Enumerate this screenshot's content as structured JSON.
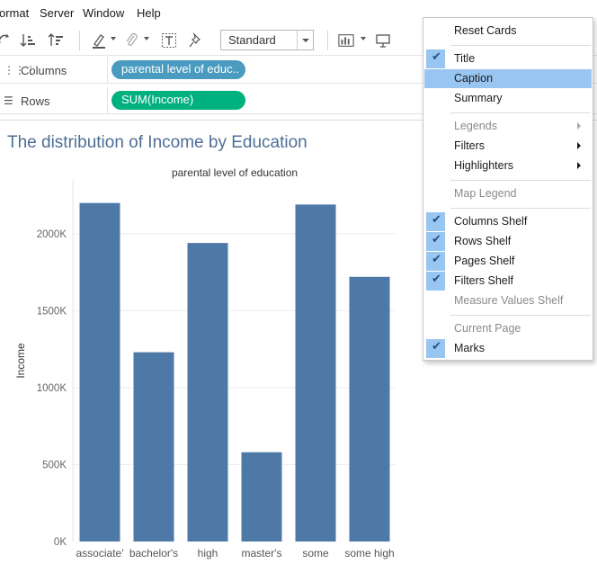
{
  "menubar": {
    "items": [
      "ormat",
      "Server",
      "Window",
      "Help"
    ]
  },
  "toolbar": {
    "view_mode": "Standard"
  },
  "shelves": {
    "columns": {
      "label": "Columns",
      "pill": "parental level of educ.."
    },
    "rows": {
      "label": "Rows",
      "pill": "SUM(Income)"
    }
  },
  "worksheet": {
    "title": "The distribution of Income by Education"
  },
  "chart_data": {
    "type": "bar",
    "column_header": "parental level of education",
    "categories": [
      "associate'",
      "bachelor's",
      "high",
      "master's",
      "some",
      "some high"
    ],
    "values": [
      2200000,
      1230000,
      1940000,
      580000,
      2190000,
      1720000
    ],
    "ylabel": "Income",
    "yticks": [
      "0K",
      "500K",
      "1000K",
      "1500K",
      "2000K"
    ],
    "ytick_values": [
      0,
      500000,
      1000000,
      1500000,
      2000000
    ],
    "ylim": [
      0,
      2350000
    ],
    "bar_color": "#4e79a7",
    "grid": true
  },
  "context_menu": {
    "items": [
      {
        "label": "Reset Cards",
        "checked": false,
        "disabled": false,
        "submenu": false,
        "highlighted": false
      },
      {
        "separator": true
      },
      {
        "label": "Title",
        "checked": true,
        "disabled": false,
        "submenu": false,
        "highlighted": false
      },
      {
        "label": "Caption",
        "checked": false,
        "disabled": false,
        "submenu": false,
        "highlighted": true
      },
      {
        "label": "Summary",
        "checked": false,
        "disabled": false,
        "submenu": false,
        "highlighted": false
      },
      {
        "separator": true
      },
      {
        "label": "Legends",
        "checked": false,
        "disabled": true,
        "submenu": true,
        "highlighted": false
      },
      {
        "label": "Filters",
        "checked": false,
        "disabled": false,
        "submenu": true,
        "highlighted": false
      },
      {
        "label": "Highlighters",
        "checked": false,
        "disabled": false,
        "submenu": true,
        "highlighted": false
      },
      {
        "separator": true
      },
      {
        "label": "Map Legend",
        "checked": false,
        "disabled": true,
        "submenu": false,
        "highlighted": false
      },
      {
        "separator": true
      },
      {
        "label": "Columns Shelf",
        "checked": true,
        "disabled": false,
        "submenu": false,
        "highlighted": false
      },
      {
        "label": "Rows Shelf",
        "checked": true,
        "disabled": false,
        "submenu": false,
        "highlighted": false
      },
      {
        "label": "Pages Shelf",
        "checked": true,
        "disabled": false,
        "submenu": false,
        "highlighted": false
      },
      {
        "label": "Filters Shelf",
        "checked": true,
        "disabled": false,
        "submenu": false,
        "highlighted": false
      },
      {
        "label": "Measure Values Shelf",
        "checked": false,
        "disabled": true,
        "submenu": false,
        "highlighted": false
      },
      {
        "separator": true
      },
      {
        "label": "Current Page",
        "checked": false,
        "disabled": true,
        "submenu": false,
        "highlighted": false
      },
      {
        "label": "Marks",
        "checked": true,
        "disabled": false,
        "submenu": false,
        "highlighted": false
      }
    ]
  },
  "colors": {
    "accent_highlight": "#99c6f0",
    "title_color": "#4e6e94",
    "columns_pill": "#4a9bbf",
    "rows_pill": "#00b180"
  }
}
